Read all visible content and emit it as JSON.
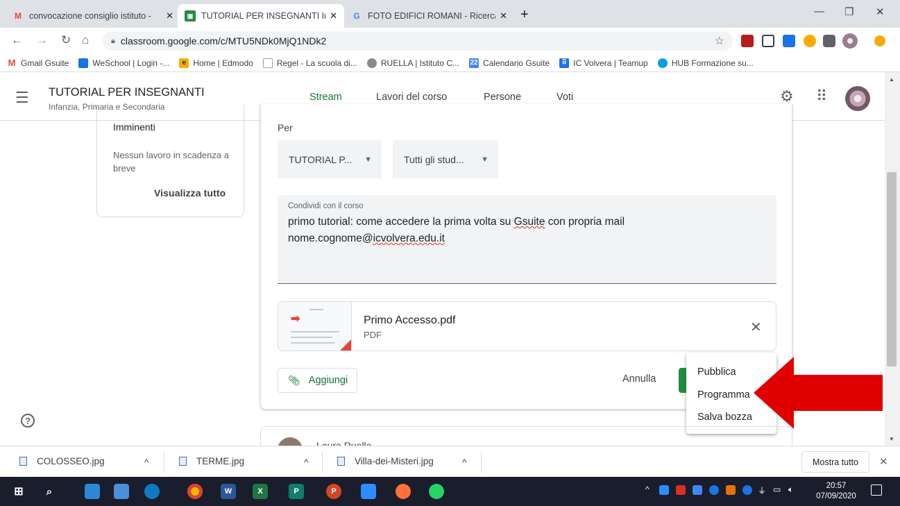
{
  "browser": {
    "tabs": [
      {
        "title": "convocazione consiglio istituto -",
        "icon": "gmail-icon"
      },
      {
        "title": "TUTORIAL PER INSEGNANTI Infar",
        "icon": "classroom-icon"
      },
      {
        "title": "FOTO EDIFICI ROMANI - Ricerca (",
        "icon": "google-icon"
      }
    ],
    "url": "classroom.google.com/c/MTU5NDk0MjQ1NDk2",
    "bookmarks": [
      {
        "label": "Gmail Gsuite",
        "color": "#ea4335"
      },
      {
        "label": "WeSchool | Login -...",
        "color": "#1a73e8"
      },
      {
        "label": "Home | Edmodo",
        "color": "#f9ab00"
      },
      {
        "label": "Regel - La scuola di...",
        "color": "#9aa0a6"
      },
      {
        "label": "RUELLA | Istituto C...",
        "color": "#9aa0a6"
      },
      {
        "label": "Calendario Gsuite",
        "color": "#4285f4"
      },
      {
        "label": "IC Volvera | Teamup",
        "color": "#1a73e8"
      },
      {
        "label": "HUB Formazione su...",
        "color": "#4285f4"
      }
    ]
  },
  "header": {
    "course_title": "TUTORIAL PER INSEGNANTI",
    "course_subtitle": "Infanzia, Primaria e Secondaria",
    "nav_tabs": [
      "Stream",
      "Lavori del corso",
      "Persone",
      "Voti"
    ],
    "active_tab": "Stream"
  },
  "upcoming": {
    "title": "Imminenti",
    "empty_text": "Nessun lavoro in scadenza a breve",
    "view_all": "Visualizza tutto"
  },
  "composer": {
    "for_label": "Per",
    "class_select": "TUTORIAL P...",
    "students_select": "Tutti gli stud...",
    "share_label": "Condividi con il corso",
    "share_line1_pre": "primo tutorial:  come accedere la prima volta su ",
    "share_line1_word": "Gsuite",
    "share_line1_post": " con propria mail",
    "share_line2_pre": "nome.cognome@",
    "share_line2_word": "icvolvera.edu.it",
    "attachment": {
      "name": "Primo Accesso.pdf",
      "type": "PDF"
    },
    "add_label": "Aggiungi",
    "cancel_label": "Annulla"
  },
  "post_menu": [
    "Pubblica",
    "Programma",
    "Salva bozza"
  ],
  "next_post_author": "Laura Ruella",
  "downloads": [
    {
      "name": "COLOSSEO.jpg"
    },
    {
      "name": "TERME.jpg"
    },
    {
      "name": "Villa-dei-Misteri.jpg"
    }
  ],
  "downloads_show_all": "Mostra tutto",
  "taskbar": {
    "time": "20:57",
    "date": "07/09/2020"
  },
  "colors": {
    "accent_green": "#137333",
    "arrow_red": "#e00000"
  }
}
